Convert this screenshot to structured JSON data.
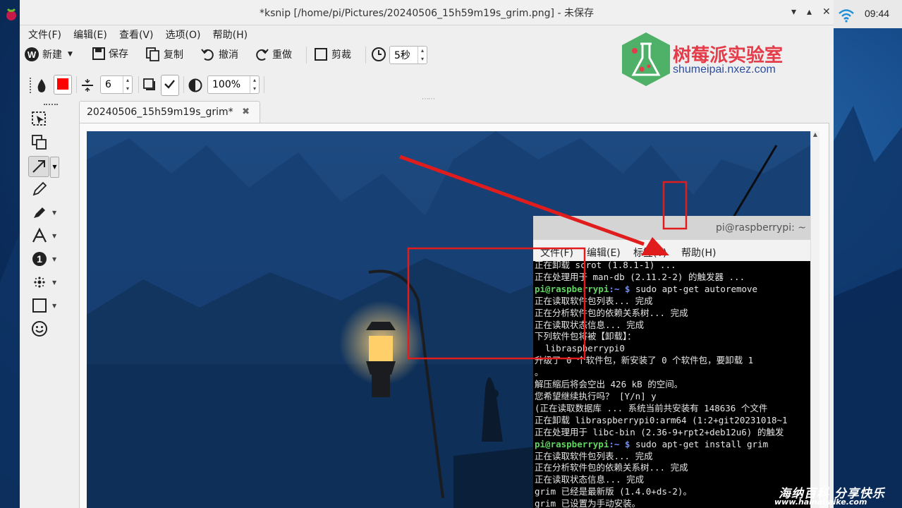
{
  "window": {
    "title": "*ksnip [/home/pi/Pictures/20240506_15h59m19s_grim.png] - 未保存",
    "controls": [
      "▾",
      "▴",
      "✕"
    ]
  },
  "menu": [
    "文件(F)",
    "编辑(E)",
    "查看(V)",
    "选项(O)",
    "帮助(H)"
  ],
  "toolbar": {
    "new": "新建",
    "save": "保存",
    "copy": "复制",
    "undo": "撤消",
    "redo": "重做",
    "crop": "剪裁",
    "delay": "5秒"
  },
  "tool_options": {
    "color": "#ff0000",
    "width": "6",
    "opacity": "100%"
  },
  "tab": {
    "label": "20240506_15h59m19s_grim*",
    "close": "✖"
  },
  "tray": {
    "time": "09:44"
  },
  "logo": {
    "name": "树莓派实验室",
    "url": "shumeipai.nxez.com"
  },
  "watermark": {
    "line1": "海纳百科 分享快乐",
    "line2": "www.hainabaike.com"
  },
  "terminal": {
    "title": "pi@raspberrypi: ~",
    "menu": [
      "文件(F)",
      "编辑(E)",
      "标签(T)",
      "帮助(H)"
    ],
    "lines": [
      {
        "t": "正在卸载 scrot (1.8.1-1) ..."
      },
      {
        "t": "正在处理用于 man-db (2.11.2-2) 的触发器 ..."
      },
      {
        "prompt": "pi@raspberrypi",
        "cwd": ":~ $",
        "t": " sudo apt-get autoremove"
      },
      {
        "t": "正在读取软件包列表... 完成"
      },
      {
        "t": "正在分析软件包的依赖关系树... 完成"
      },
      {
        "t": "正在读取状态信息... 完成"
      },
      {
        "t": "下列软件包将被【卸载】："
      },
      {
        "t": "  libraspberrypi0"
      },
      {
        "t": "升级了 0 个软件包，新安装了 0 个软件包，要卸载 1"
      },
      {
        "t": "。"
      },
      {
        "t": "解压缩后将会空出 426 kB 的空间。"
      },
      {
        "t": "您希望继续执行吗？ [Y/n] y"
      },
      {
        "t": "(正在读取数据库 ... 系统当前共安装有 148636 个文件"
      },
      {
        "t": "正在卸载 libraspberrypi0:arm64 (1:2+git20231018~1"
      },
      {
        "t": "正在处理用于 libc-bin (2.36-9+rpt2+deb12u6) 的触发"
      },
      {
        "prompt": "pi@raspberrypi",
        "cwd": ":~ $",
        "t": " sudo apt-get install grim"
      },
      {
        "t": "正在读取软件包列表... 完成"
      },
      {
        "t": "正在分析软件包的依赖关系树... 完成"
      },
      {
        "t": "正在读取状态信息... 完成"
      },
      {
        "t": "grim 已经是最新版 (1.4.0+ds-2)。"
      },
      {
        "t": "grim 已设置为手动安装。"
      }
    ]
  },
  "annotation_color": "#e01c1c"
}
